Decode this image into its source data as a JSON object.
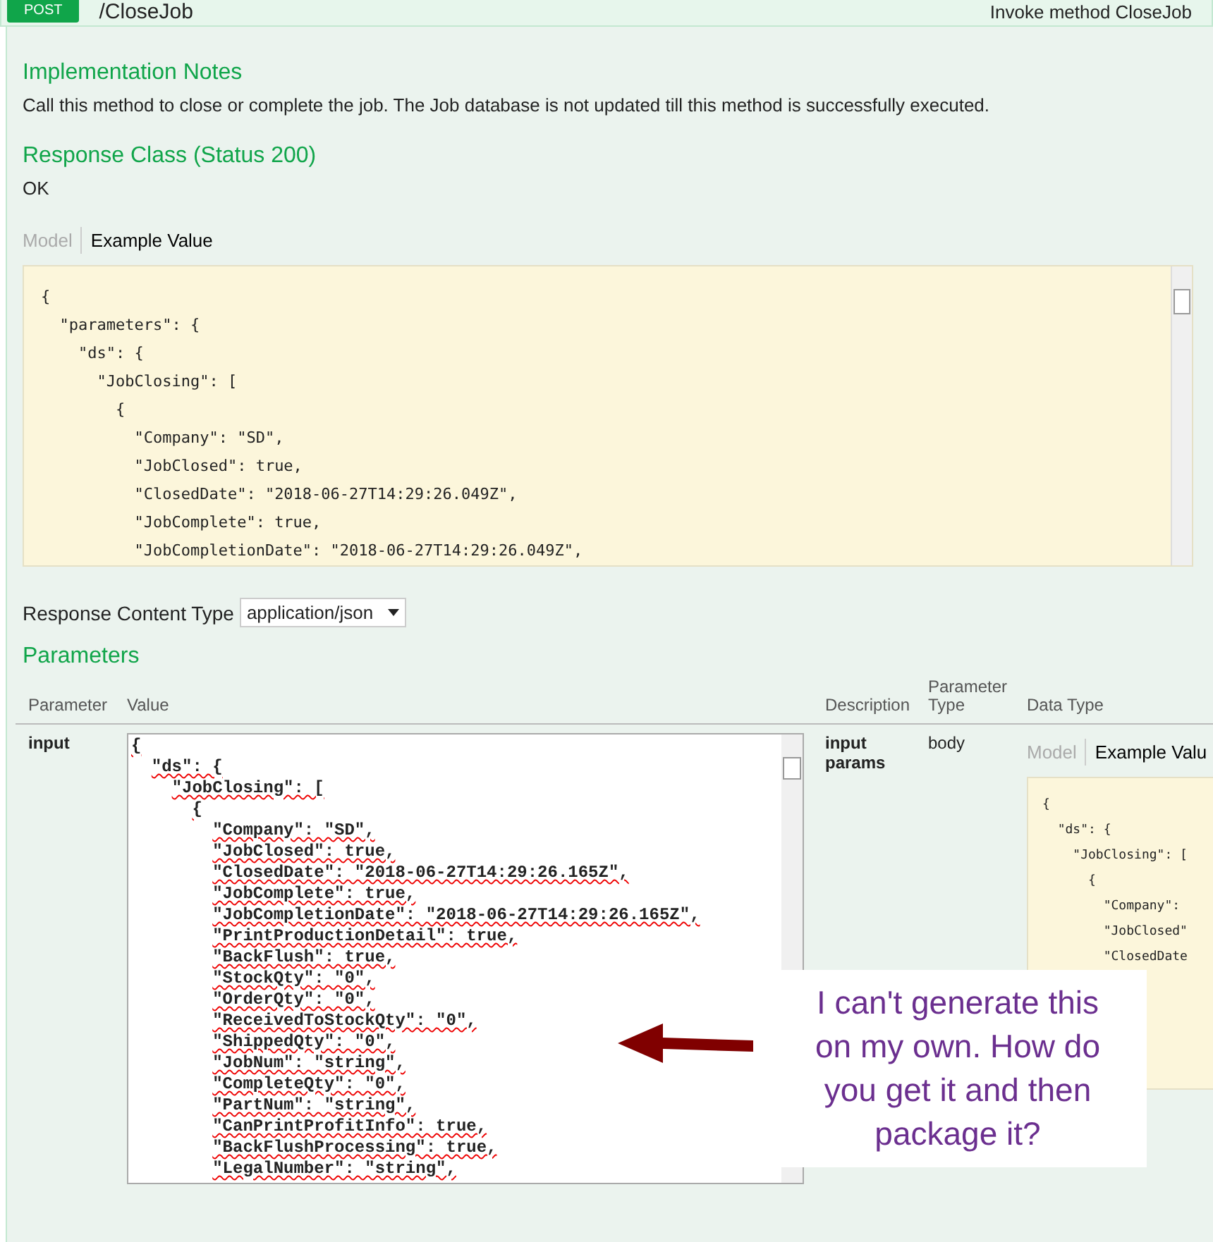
{
  "operation": {
    "method": "POST",
    "path": "/CloseJob",
    "summary": "Invoke method CloseJob"
  },
  "implementation_notes": {
    "heading": "Implementation Notes",
    "text": "Call this method to close or complete the job. The Job database is not updated till this method is successfully executed."
  },
  "response_class": {
    "heading": "Response Class (Status 200)",
    "text": "OK",
    "tabs": [
      {
        "label": "Model",
        "selected": false
      },
      {
        "label": "Example Value",
        "selected": true
      }
    ],
    "example_lines": [
      "{",
      "  \"parameters\": {",
      "    \"ds\": {",
      "      \"JobClosing\": [",
      "        {",
      "          \"Company\": \"SD\",",
      "          \"JobClosed\": true,",
      "          \"ClosedDate\": \"2018-06-27T14:29:26.049Z\",",
      "          \"JobComplete\": true,",
      "          \"JobCompletionDate\": \"2018-06-27T14:29:26.049Z\","
    ]
  },
  "response_content_type": {
    "label": "Response Content Type",
    "value": "application/json"
  },
  "parameters": {
    "heading": "Parameters",
    "columns": [
      "Parameter",
      "Value",
      "Description",
      "Parameter Type",
      "Data Type"
    ],
    "rows": [
      {
        "parameter": "input",
        "value_lines": [
          "{",
          "  \"ds\": {",
          "    \"JobClosing\": [",
          "      {",
          "        \"Company\": \"SD\",",
          "        \"JobClosed\": true,",
          "        \"ClosedDate\": \"2018-06-27T14:29:26.165Z\",",
          "        \"JobComplete\": true,",
          "        \"JobCompletionDate\": \"2018-06-27T14:29:26.165Z\",",
          "        \"PrintProductionDetail\": true,",
          "        \"BackFlush\": true,",
          "        \"StockQty\": \"0\",",
          "        \"OrderQty\": \"0\",",
          "        \"ReceivedToStockQty\": \"0\",",
          "        \"ShippedQty\": \"0\",",
          "        \"JobNum\": \"string\",",
          "        \"CompleteQty\": \"0\",",
          "        \"PartNum\": \"string\",",
          "        \"CanPrintProfitInfo\": true,",
          "        \"BackFlushProcessing\": true,",
          "        \"LegalNumber\": \"string\","
        ],
        "description": "input params",
        "parameter_type": "body",
        "data_type_tabs": [
          {
            "label": "Model",
            "selected": false
          },
          {
            "label": "Example Valu",
            "selected": true
          }
        ],
        "data_type_lines": [
          "{",
          "  \"ds\": {",
          "    \"JobClosing\": [",
          "      {",
          "        \"Company\":",
          "        \"JobClosed\"",
          "        \"ClosedDate"
        ]
      }
    ]
  },
  "annotation": {
    "text": "I can't generate this on my own. How do you get it and then package it?"
  }
}
